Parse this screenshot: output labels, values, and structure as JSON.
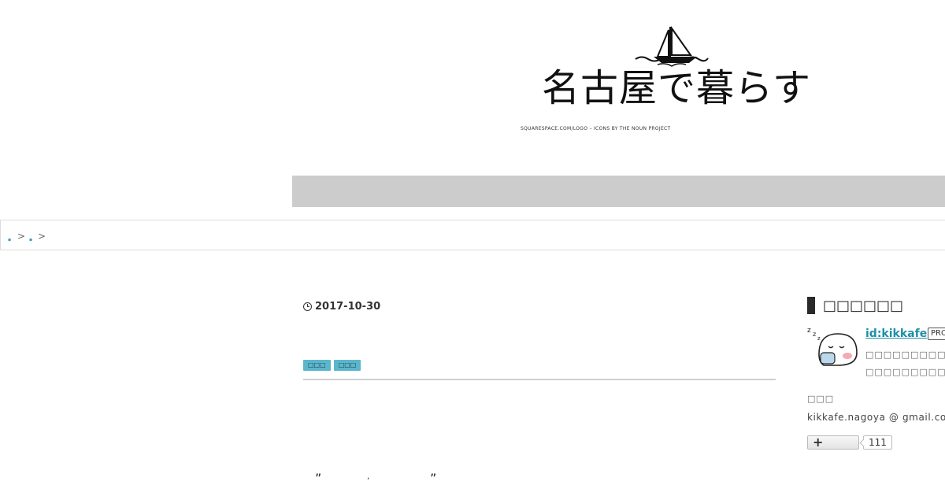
{
  "header": {
    "site_title": "名古屋で暮らす",
    "logo_credit": "SQUARESPACE.COM/LOGO – ICONS BY THE NOUN PROJECT"
  },
  "breadcrumb": {
    "items": [
      {
        "label": "▪",
        "sep": ">"
      },
      {
        "label": "▪",
        "sep": ">"
      }
    ]
  },
  "article": {
    "date": "2017-10-30",
    "tags": [
      "□□□",
      "□□□"
    ],
    "quote_open": "”",
    "quote_comma": ",",
    "quote_close": "”"
  },
  "sidebar": {
    "heading": "□□□□□□",
    "profile": {
      "id": "id:kikkafe",
      "badge": "PRO",
      "desc_line1": "□□□□□□□□□□□□□□",
      "desc_line2": "□□□□□□□□□□□□□□",
      "contact_label": "□□□",
      "email": "kikkafe.nagoya @ gmail.com"
    },
    "follow": {
      "count": "111",
      "icon": "plus-icon"
    }
  },
  "colors": {
    "nav_bar": "#cccccc",
    "tag_bg": "#5bb6cc",
    "link": "#1f8fa8"
  }
}
